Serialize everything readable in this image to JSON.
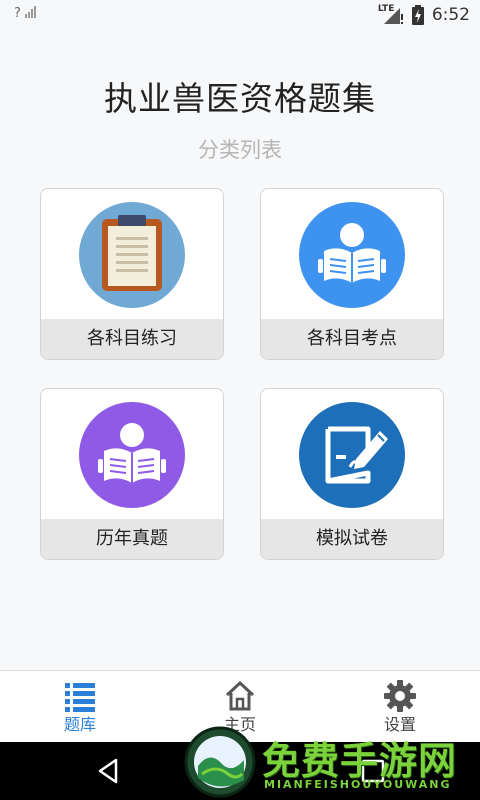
{
  "status_bar": {
    "signal_left": "?",
    "network": "LTE",
    "time": "6:52"
  },
  "header": {
    "title": "执业兽医资格题集",
    "subtitle": "分类列表"
  },
  "cards": [
    {
      "label": "各科目练习",
      "icon": "clipboard-icon",
      "icon_bg": "#6fa9d4"
    },
    {
      "label": "各科目考点",
      "icon": "reader-icon",
      "icon_bg": "#3d93ef"
    },
    {
      "label": "历年真题",
      "icon": "reader-icon",
      "icon_bg": "#8f5be6"
    },
    {
      "label": "模拟试卷",
      "icon": "edit-paper-icon",
      "icon_bg": "#1c6fb8"
    }
  ],
  "tabs": [
    {
      "label": "题库",
      "icon": "list-icon",
      "active": true
    },
    {
      "label": "主页",
      "icon": "home-icon",
      "active": false
    },
    {
      "label": "设置",
      "icon": "gear-icon",
      "active": false
    }
  ],
  "watermark": {
    "text": "免费手游网",
    "sub": "MIANFEISHOUYOUWANG"
  },
  "colors": {
    "accent": "#2b7fd8",
    "card_label_bg": "#e6e6e6",
    "subtitle": "#b5b5b5"
  }
}
